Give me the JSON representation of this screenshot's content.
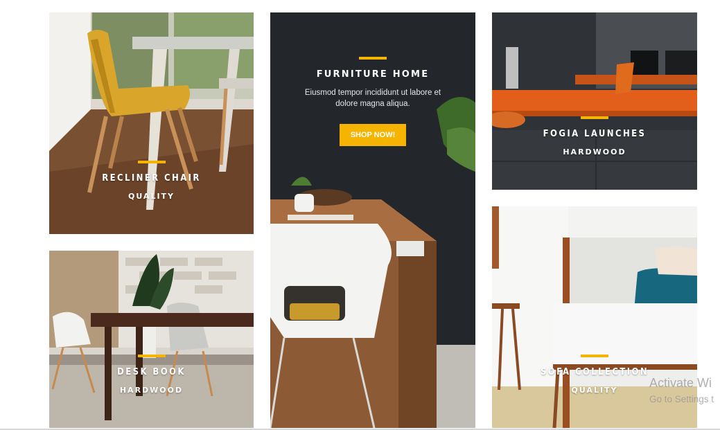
{
  "colors": {
    "accent": "#f4b400"
  },
  "tiles": [
    {
      "title": "RECLINER CHAIR",
      "subtitle": "QUALITY"
    },
    {
      "title": "DESK BOOK",
      "subtitle": "HARDWOOD"
    },
    {
      "title": "FOGIA LAUNCHES",
      "subtitle": "HARDWOOD"
    },
    {
      "title": "SOFA COLLECTION",
      "subtitle": "QUALITY"
    }
  ],
  "hero": {
    "title": "FURNITURE HOME",
    "text": "Eiusmod tempor incididunt ut labore et dolore magna aliqua.",
    "button_label": "SHOP NOW!"
  },
  "watermark": {
    "line1": "Activate Wi",
    "line2": "Go to Settings t"
  }
}
